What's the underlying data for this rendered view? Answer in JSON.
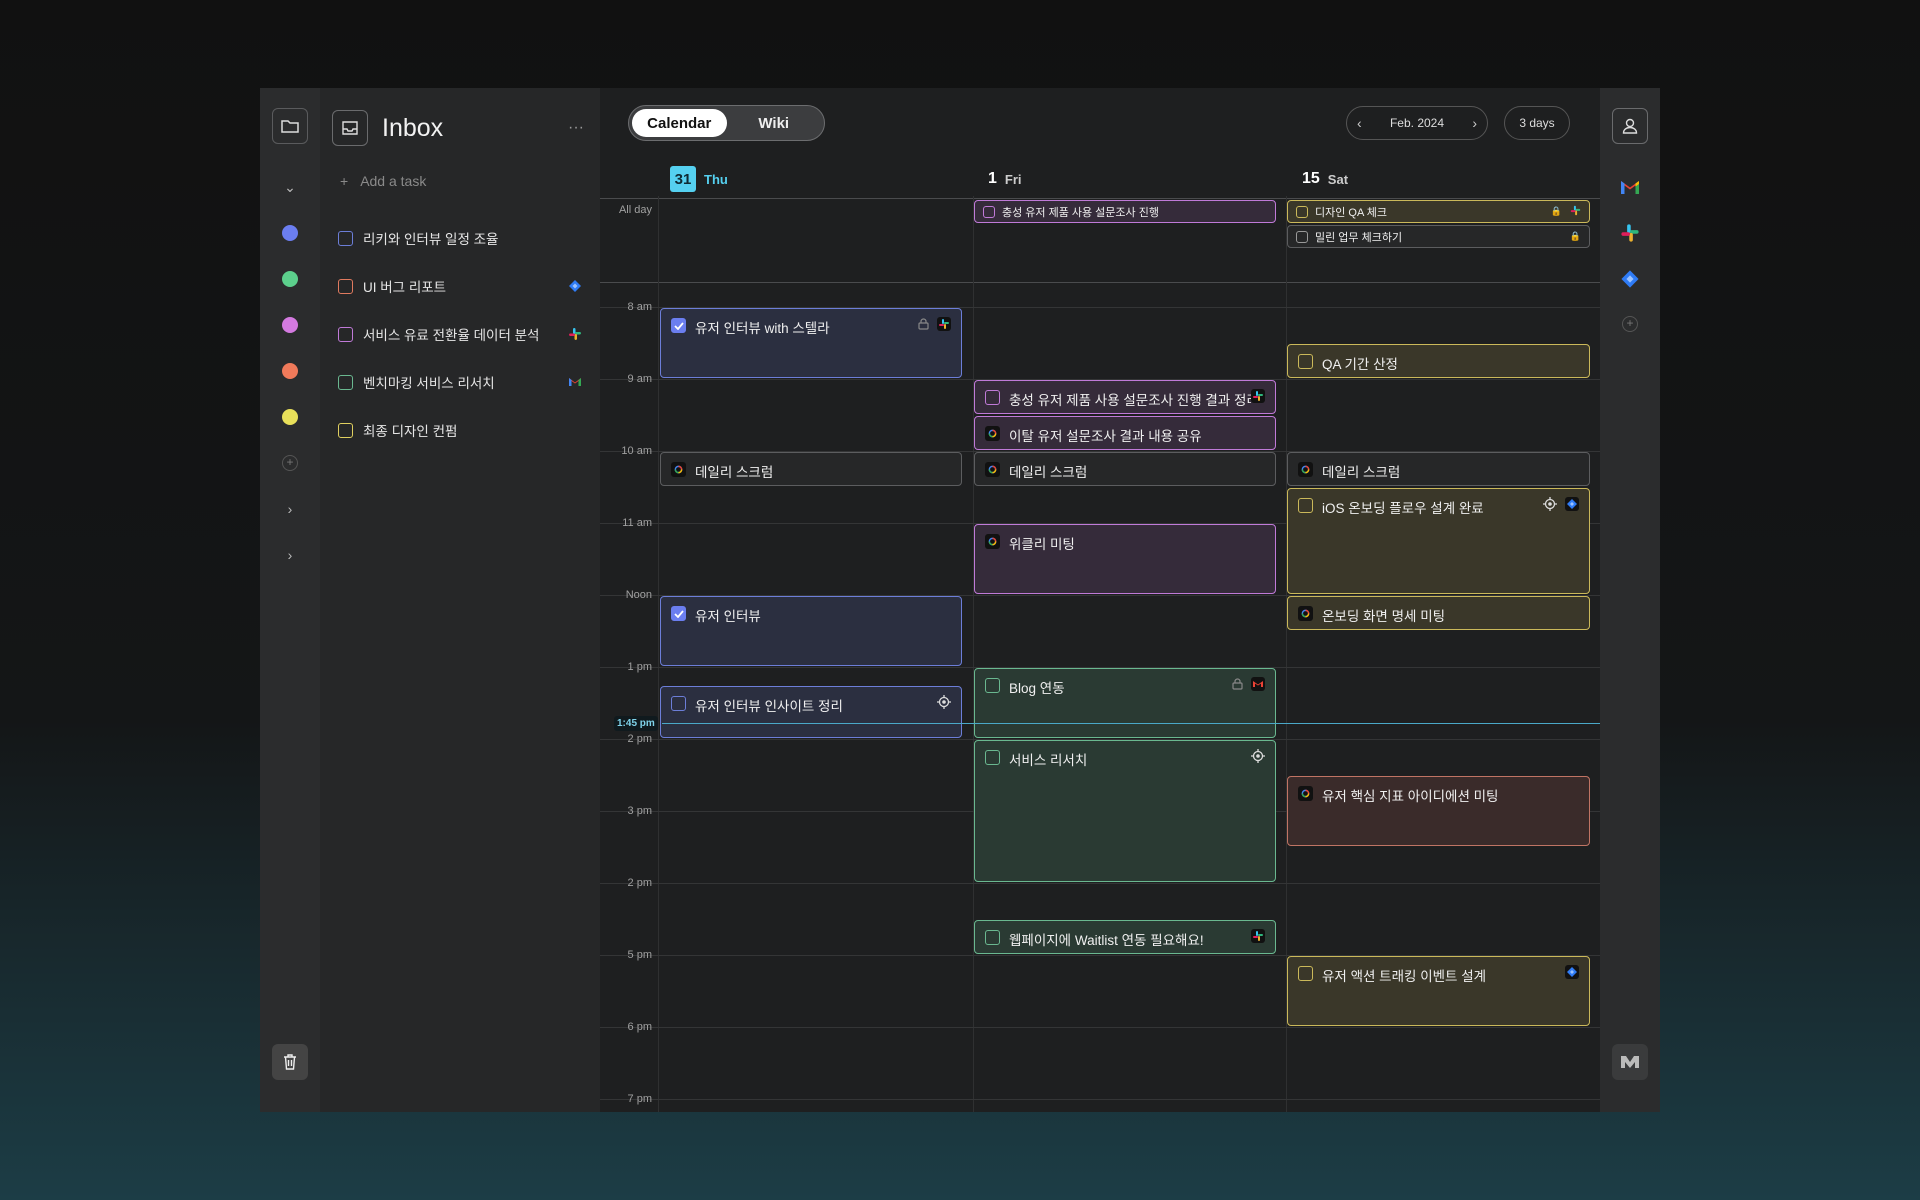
{
  "inbox": {
    "title": "Inbox",
    "add_task_placeholder": "Add a task",
    "tasks": [
      {
        "label": "리키와 인터뷰 일정 조율",
        "color": "#6c7ed8",
        "service": ""
      },
      {
        "label": "UI 버그 리포트",
        "color": "#e07a5f",
        "service": "jira-icon"
      },
      {
        "label": "서비스 유료 전환율 데이터 분석",
        "color": "#c07ad8",
        "service": "slack-icon"
      },
      {
        "label": "벤치마킹 서비스 리서치",
        "color": "#6ab890",
        "service": "gmail-icon"
      },
      {
        "label": "최종 디자인 컨펌",
        "color": "#e0d060",
        "service": ""
      }
    ]
  },
  "rail": {
    "project_colors": [
      "#6b7ef0",
      "#5cd08c",
      "#d47ae0",
      "#f07a5a",
      "#e8e05a"
    ]
  },
  "topbar": {
    "tabs": [
      {
        "label": "Calendar",
        "active": true
      },
      {
        "label": "Wiki",
        "active": false
      }
    ],
    "month": "Feb. 2024",
    "range": "3 days"
  },
  "days": [
    {
      "num": "31",
      "name": "Thu",
      "today": true
    },
    {
      "num": "1",
      "name": "Fri",
      "today": false
    },
    {
      "num": "15",
      "name": "Sat",
      "today": false
    }
  ],
  "allday_label": "All day",
  "hours": [
    "8 am",
    "9 am",
    "10 am",
    "11 am",
    "Noon",
    "1 pm",
    "2 pm",
    "3 pm",
    "2 pm",
    "5 pm",
    "6 pm",
    "7 pm"
  ],
  "now_label": "1:45 pm",
  "allday_events": [
    {
      "title": "충성 유저 제품 사용 설문조사 진행",
      "color": "purple"
    },
    {
      "title": "디자인 QA 체크",
      "color": "yellow"
    },
    {
      "title": "밀린 업무 체크하기",
      "color": "gray"
    }
  ],
  "events": [
    {
      "title": "유저 인터뷰 with 스텔라",
      "color": "blue"
    },
    {
      "title": "데일리 스크럼",
      "color": "gray"
    },
    {
      "title": "유저 인터뷰",
      "color": "blue"
    },
    {
      "title": "유저 인터뷰 인사이트 정리",
      "color": "blue"
    },
    {
      "title": "충성 유저 제품 사용 설문조사 진행 결과 정리",
      "color": "purple"
    },
    {
      "title": "이탈 유저 설문조사 결과 내용 공유",
      "color": "purple"
    },
    {
      "title": "데일리 스크럼",
      "color": "gray"
    },
    {
      "title": "위클리 미팅",
      "color": "purple"
    },
    {
      "title": "Blog 연동",
      "color": "green"
    },
    {
      "title": "서비스 리서치",
      "color": "green"
    },
    {
      "title": "웹페이지에 Waitlist 연동 필요해요!",
      "color": "green"
    },
    {
      "title": "QA 기간 산정",
      "color": "yellow"
    },
    {
      "title": "데일리 스크럼",
      "color": "gray"
    },
    {
      "title": "iOS 온보딩 플로우 설계 완료",
      "color": "yellow"
    },
    {
      "title": "온보딩 화면 명세 미팅",
      "color": "yellow"
    },
    {
      "title": "유저 핵심 지표 아이디에션 미팅",
      "color": "red"
    },
    {
      "title": "유저 액션 트래킹 이벤트 설계",
      "color": "yellow"
    }
  ]
}
